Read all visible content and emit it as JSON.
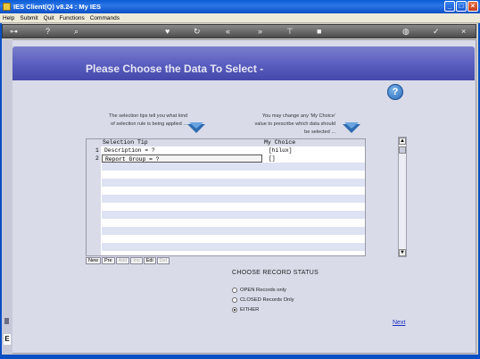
{
  "window": {
    "title": "IES Client(Q) v8.24 : My IES"
  },
  "menu": {
    "items": [
      "Help",
      "Submit",
      "Quit",
      "Functions",
      "Commands"
    ]
  },
  "page": {
    "title": "Please Choose the Data To Select -"
  },
  "tips": {
    "left": [
      "The selection tips tell you what kind",
      "of selection rule is being applied ..."
    ],
    "right": [
      "You may change any 'My Choice'",
      "value to prescribe which data should",
      "be selected ..."
    ]
  },
  "grid": {
    "headers": {
      "tip": "Selection Tip",
      "choice": "My Choice"
    },
    "rows": [
      {
        "num": "1",
        "tip": "Description = ?",
        "choice": "[hilux]"
      },
      {
        "num": "2",
        "tip": "Report Group = ?",
        "choice": "[]"
      }
    ],
    "buttons": [
      {
        "label": "New",
        "enabled": true
      },
      {
        "label": "Pre",
        "enabled": true
      },
      {
        "label": "Add",
        "enabled": false
      },
      {
        "label": "Ins",
        "enabled": false
      },
      {
        "label": "Edi",
        "enabled": true
      },
      {
        "label": "Del",
        "enabled": false
      }
    ]
  },
  "status": {
    "title": "CHOOSE RECORD STATUS",
    "options": [
      {
        "label": "OPEN Records only",
        "selected": false
      },
      {
        "label": "CLOSED Records Only",
        "selected": false
      },
      {
        "label": "EITHER",
        "selected": true
      }
    ]
  },
  "nav": {
    "next": "Next"
  },
  "side": {
    "mark": "E"
  }
}
